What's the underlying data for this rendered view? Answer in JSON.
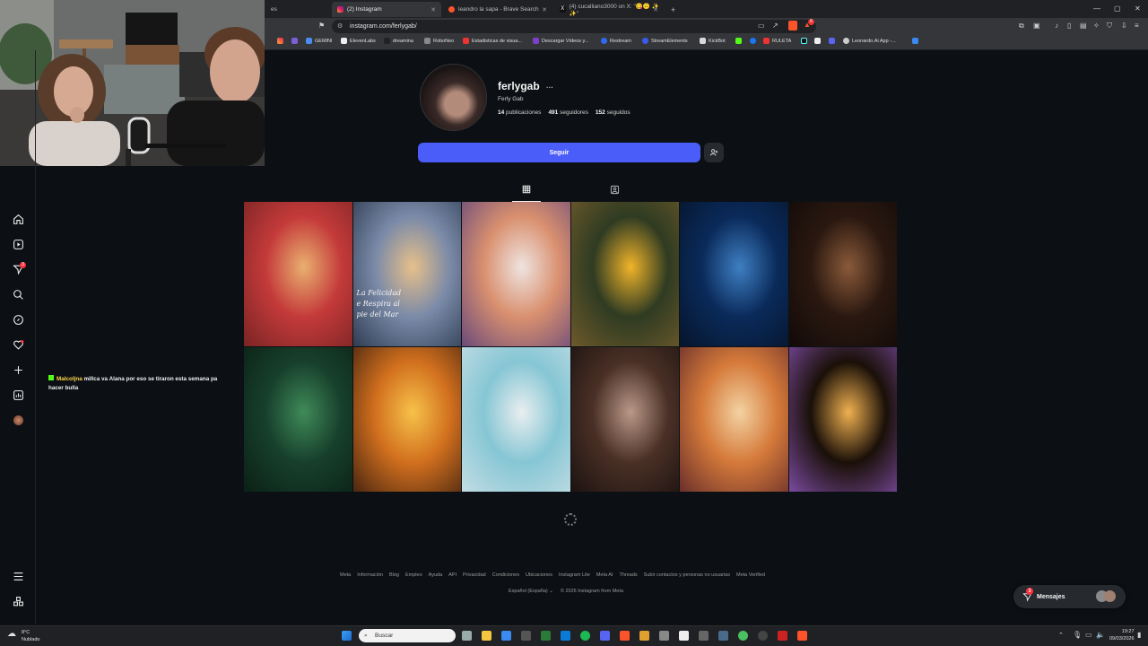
{
  "browser": {
    "tabs": [
      {
        "label": "es",
        "active": false
      },
      {
        "label": "(2) Instagram",
        "active": true
      },
      {
        "label": "leandro la sapa - Brave Search",
        "active": false
      },
      {
        "label": "(4) cucalliano3000 on X: \"😋🙃 ✨ ✨\"",
        "active": false
      }
    ],
    "new_tab": "+",
    "url": "instagram.com/ferlygab/",
    "shield_badge": "6",
    "bookmarks": [
      "GEMINI",
      "ElevenLabs",
      "dreamina",
      "RoboNeo",
      "Estadisticas de visua...",
      "Descargar Vídeos y...",
      "Restream",
      "StreamElements",
      "KickBot",
      "RULETA",
      "Leonardo.Ai App -..."
    ]
  },
  "sidebar": {
    "icons": [
      "home-icon",
      "reels-icon",
      "messages-icon",
      "search-icon",
      "explore-icon",
      "notifications-icon",
      "create-icon",
      "dashboard-icon",
      "profile-avatar",
      "more-icon",
      "meta-icon"
    ],
    "notification_badge": "3"
  },
  "profile": {
    "username": "ferlygab",
    "options": "···",
    "full_name": "Ferly Gab",
    "posts_count": "14",
    "posts_label": "publicaciones",
    "followers_count": "491",
    "followers_label": "seguidores",
    "following_count": "152",
    "following_label": "seguidos",
    "follow_label": "Seguir"
  },
  "posts": [
    {
      "subject": "drink",
      "palette": [
        "#c43a3a",
        "#e9b070",
        "#7a2424"
      ]
    },
    {
      "subject": "sunset-sea-quote",
      "palette": [
        "#7a8aa8",
        "#e7c08a",
        "#2f3d52"
      ],
      "text": "La Felicidad\ne Respira al\npie del Mar"
    },
    {
      "subject": "daisies",
      "palette": [
        "#d9906f",
        "#efe4e0",
        "#6a4a7a"
      ]
    },
    {
      "subject": "sunflowers",
      "palette": [
        "#2f3b22",
        "#f0b42a",
        "#6e5a2a"
      ]
    },
    {
      "subject": "space-planet",
      "palette": [
        "#0a2a5a",
        "#3e7fc2",
        "#06152b"
      ]
    },
    {
      "subject": "night-street",
      "palette": [
        "#2a1810",
        "#8a5a3a",
        "#110a08"
      ]
    },
    {
      "subject": "leaves-cat",
      "palette": [
        "#17402c",
        "#3f8a58",
        "#0b2016"
      ]
    },
    {
      "subject": "beach-sunset",
      "palette": [
        "#d2701e",
        "#f7c24a",
        "#4a2610"
      ]
    },
    {
      "subject": "starfish",
      "palette": [
        "#86c6d4",
        "#e9eef0",
        "#c3dde4"
      ]
    },
    {
      "subject": "tear-eye",
      "palette": [
        "#4a3026",
        "#b99888",
        "#1c1210"
      ]
    },
    {
      "subject": "balloon-clouds",
      "palette": [
        "#d57a3a",
        "#f3d2a2",
        "#6a2f2a"
      ]
    },
    {
      "subject": "candles-flowers",
      "palette": [
        "#1a1008",
        "#f0b050",
        "#7a4aa0"
      ]
    }
  ],
  "chat": {
    "user": "Malcoljna",
    "message": "millca va Alana por eso se tiraron esta semana pa hacer bulla"
  },
  "footer": {
    "links": [
      "Meta",
      "Información",
      "Blog",
      "Empleo",
      "Ayuda",
      "API",
      "Privacidad",
      "Condiciones",
      "Ubicaciones",
      "Instagram Lite",
      "Meta AI",
      "Threads",
      "Subir contactos y personas no usuarias",
      "Meta Verified"
    ],
    "language": "Español (España)",
    "copyright": "© 2026 Instagram from Meta"
  },
  "messages": {
    "label": "Mensajes",
    "badge": "3"
  },
  "taskbar": {
    "weather_temp": "8°C",
    "weather_desc": "Nublado",
    "search_placeholder": "Buscar",
    "time": "19:27",
    "date": "09/03/2026"
  },
  "colors": {
    "accent": "#4a5df9",
    "bg": "#0c1014",
    "badge": "#ff3040"
  }
}
